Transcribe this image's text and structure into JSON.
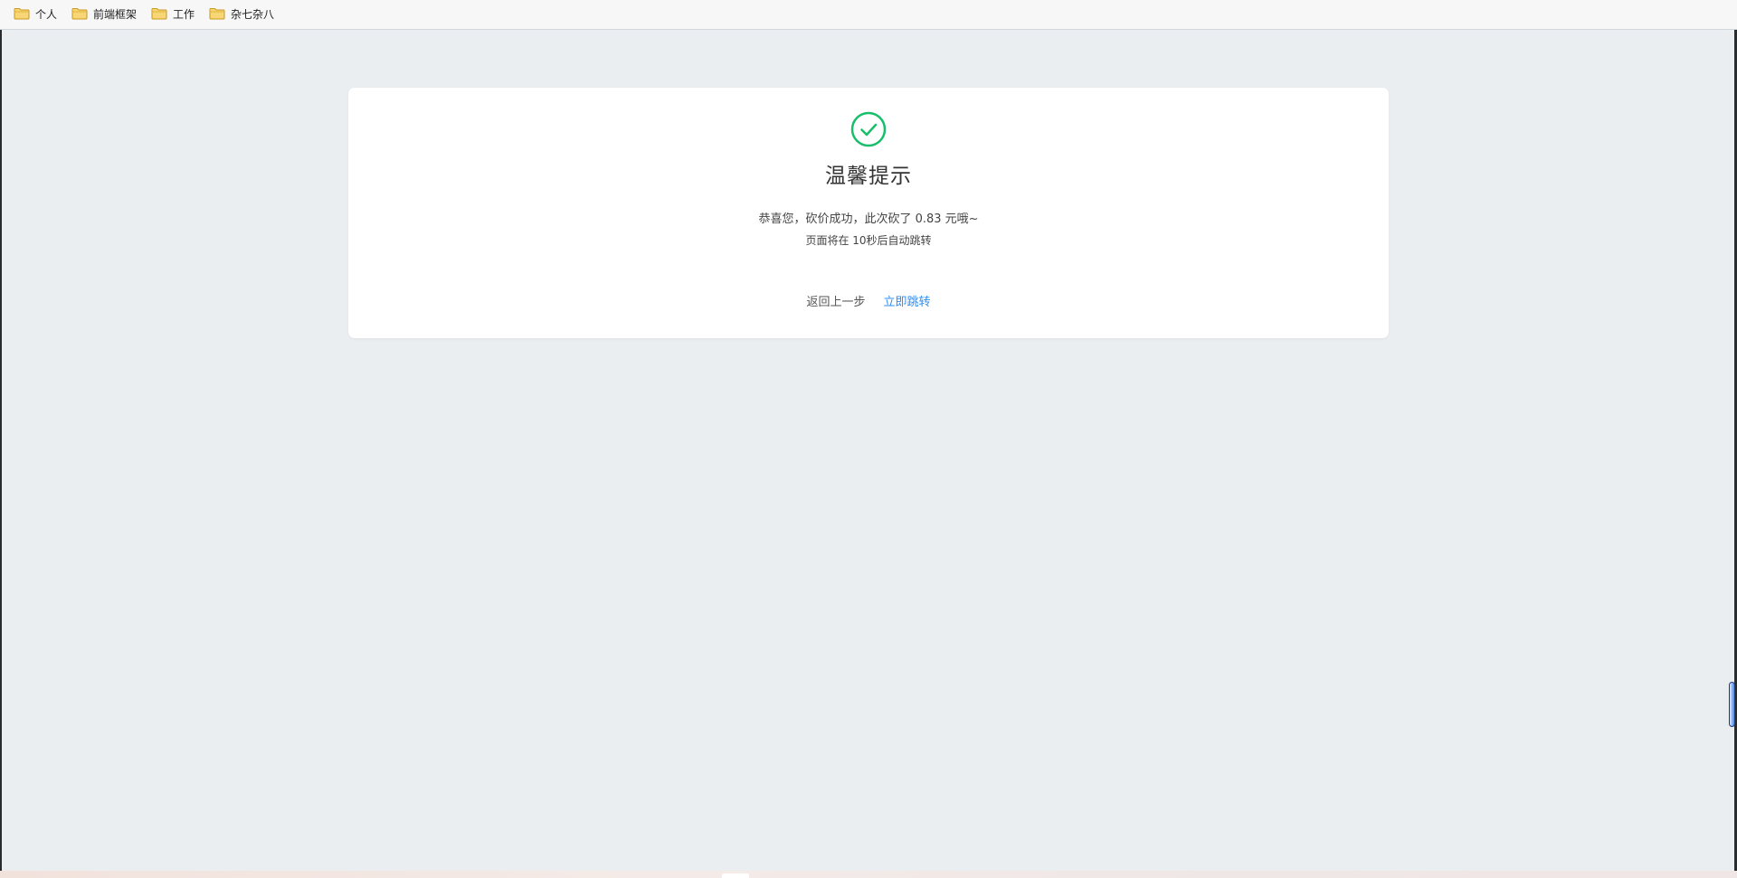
{
  "bookmarks": [
    {
      "label": "个人",
      "icon": "folder-icon"
    },
    {
      "label": "前端框架",
      "icon": "folder-icon"
    },
    {
      "label": "工作",
      "icon": "folder-icon"
    },
    {
      "label": "杂七杂八",
      "icon": "folder-icon"
    }
  ],
  "dialog": {
    "icon": "check-circle-icon",
    "title": "温馨提示",
    "message": "恭喜您，砍价成功，此次砍了 0.83 元哦~",
    "countdown": "页面将在 10秒后自动跳转",
    "back_label": "返回上一步",
    "jump_label": "立即跳转"
  },
  "colors": {
    "background": "#ebeef1",
    "card": "#ffffff",
    "success": "#19be6b",
    "link": "#2d8cf0",
    "folder": "#f5c445"
  }
}
